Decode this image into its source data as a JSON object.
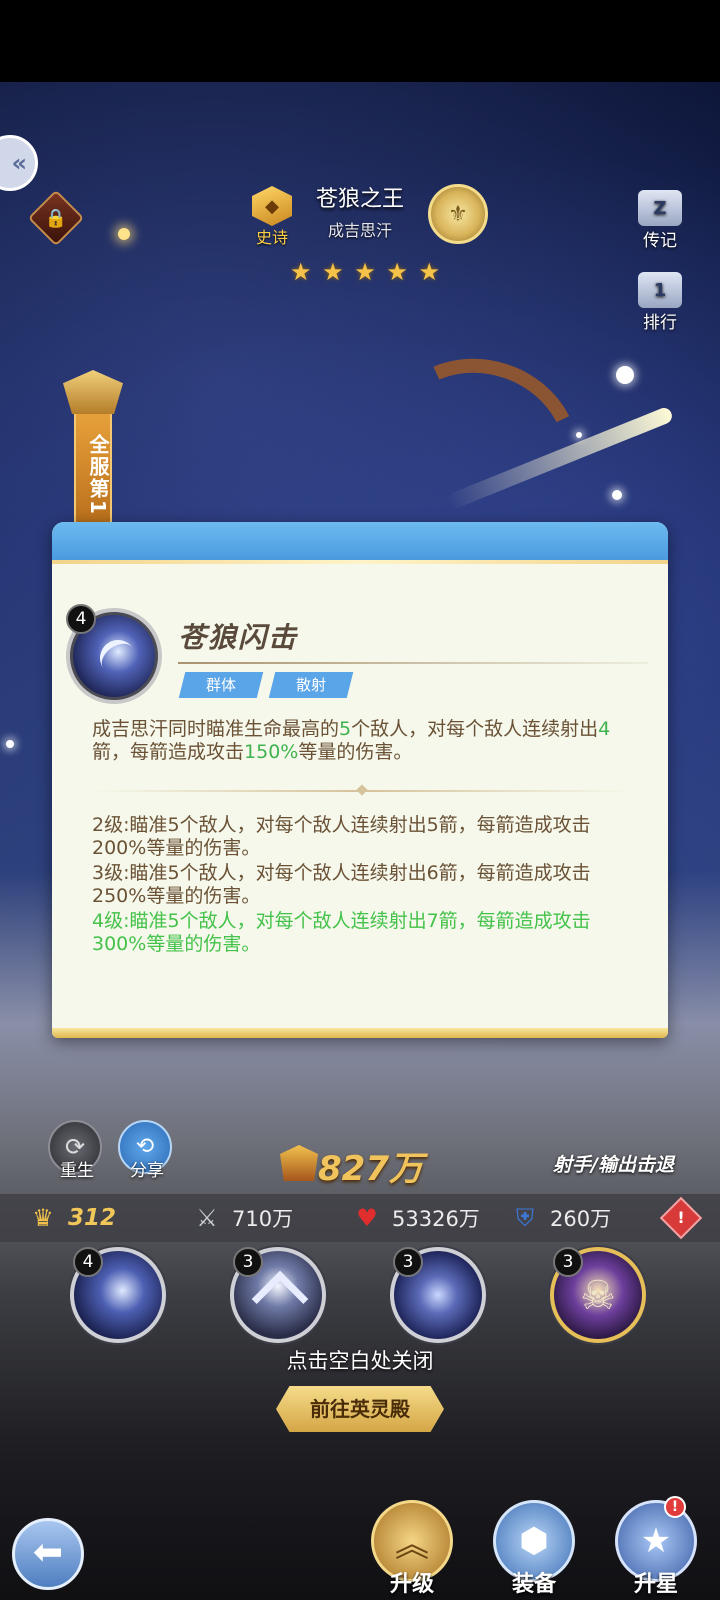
{
  "header": {
    "rarity_label": "史诗",
    "hero_title": "苍狼之王",
    "hero_name": "成吉思汗",
    "star_count": 5,
    "side_buttons": {
      "biography": "传记",
      "ranking": "排行"
    },
    "rank_ribbon": "全服第1"
  },
  "skill_card": {
    "level": "4",
    "name": "苍狼闪击",
    "tags": [
      "群体",
      "散射"
    ],
    "description": {
      "p1": "成吉思汗同时瞄准生命最高的",
      "n1": "5",
      "p2": "个敌人，对每个敌人连续射出",
      "n2": "4",
      "p3": "箭，每箭造成攻击",
      "n3": "150%",
      "p4": "等量的伤害。"
    },
    "levels": [
      {
        "text": "2级:瞄准5个敌人，对每个敌人连续射出5箭，每箭造成攻击200%等量的伤害。",
        "active": false
      },
      {
        "text": "3级:瞄准5个敌人，对每个敌人连续射出6箭，每箭造成攻击250%等量的伤害。",
        "active": false
      },
      {
        "text": "4级:瞄准5个敌人，对每个敌人连续射出7箭，每箭造成攻击300%等量的伤害。",
        "active": true
      }
    ]
  },
  "actions": {
    "rebirth": "重生",
    "share": "分享"
  },
  "power": {
    "value": "827万",
    "role": "射手/输出击退"
  },
  "stats": {
    "level": "312",
    "attack": "710万",
    "hp": "53326万",
    "defense": "260万"
  },
  "skills": [
    {
      "level": "4"
    },
    {
      "level": "3"
    },
    {
      "level": "3"
    },
    {
      "level": "3"
    }
  ],
  "close_hint": "点击空白处关闭",
  "goto_button": "前往英灵殿",
  "bottom_nav": {
    "upgrade": "升级",
    "equip": "装备",
    "star_up": "升星",
    "star_up_badge": "!"
  },
  "colors": {
    "highlight_green": "#3fb34f",
    "tag_blue": "#5aa4e8",
    "gold": "#f2c75a"
  }
}
